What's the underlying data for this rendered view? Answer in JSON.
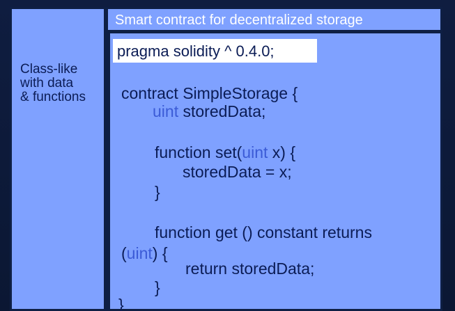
{
  "left_label": "Class-like\nwith data\n& functions",
  "header_title": "Smart contract for decentralized storage",
  "pragma": "pragma solidity ^ 0.4.0;",
  "code": {
    "line1": "contract SimpleStorage {",
    "line2_type": "uint",
    "line2_rest": " storedData;",
    "line3_pre": "function set(",
    "line3_type": "uint",
    "line3_post": " x) {",
    "line4": "storedData = x;",
    "line5": "}",
    "line6": "function get () constant returns",
    "line7_open": "(",
    "line7_type": "uint",
    "line7_post": ")  {",
    "line8": "return storedData;",
    "line9": "}",
    "line10": "}"
  },
  "colors": {
    "panel_blue": "#7fa1ff",
    "frame_dark": "#0e1f44",
    "code_text": "#0b1c55",
    "type_keyword": "#3b5bd6"
  }
}
